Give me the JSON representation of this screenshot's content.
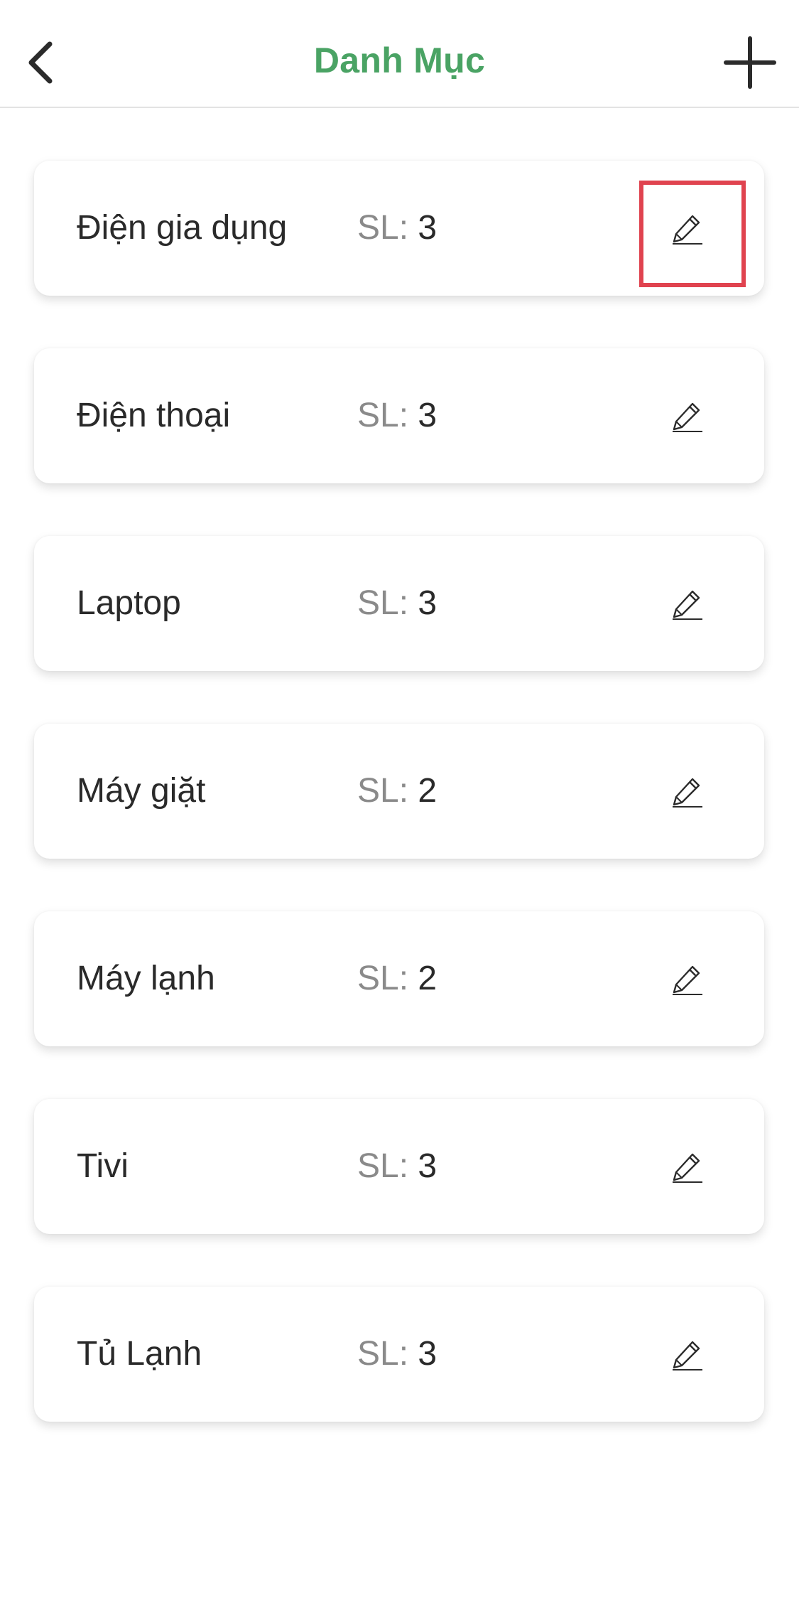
{
  "navbar": {
    "title": "Danh Mục",
    "title_color": "#4aa364",
    "back_icon": "chevron-left-icon",
    "add_icon": "plus-icon"
  },
  "categories": {
    "qty_label": "SL: ",
    "edit_icon": "pencil-icon",
    "highlight_color": "#e0434f",
    "items": [
      {
        "name": "Điện gia dụng",
        "qty": "3",
        "highlighted": true
      },
      {
        "name": "Điện thoại",
        "qty": "3",
        "highlighted": false
      },
      {
        "name": "Laptop",
        "qty": "3",
        "highlighted": false
      },
      {
        "name": "Máy giặt",
        "qty": "2",
        "highlighted": false
      },
      {
        "name": "Máy lạnh",
        "qty": "2",
        "highlighted": false
      },
      {
        "name": "Tivi",
        "qty": "3",
        "highlighted": false
      },
      {
        "name": "Tủ Lạnh",
        "qty": "3",
        "highlighted": false
      }
    ]
  }
}
